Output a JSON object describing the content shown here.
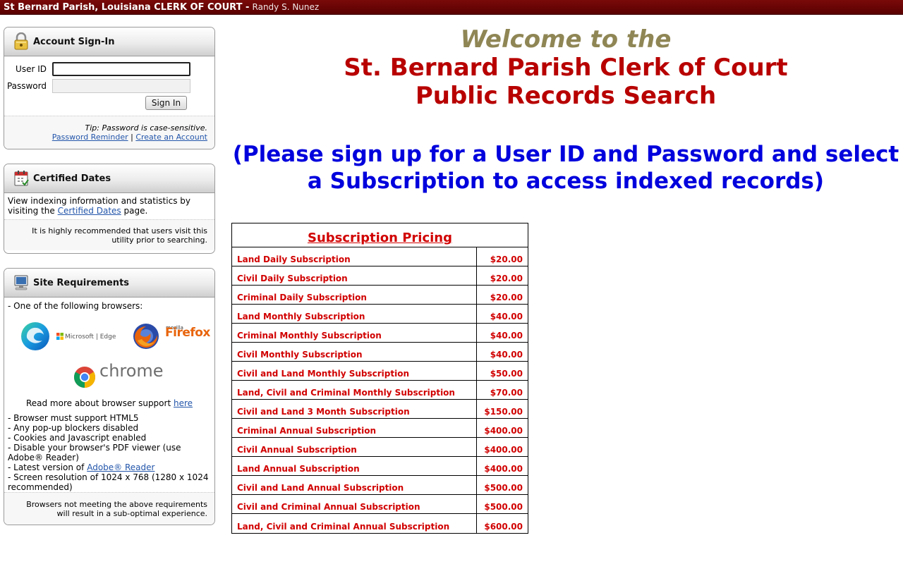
{
  "header": {
    "site_title": "St Bernard Parish, Louisiana CLERK OF COURT -",
    "clerk_name": "Randy S. Nunez"
  },
  "signin": {
    "title": "Account Sign-In",
    "icon": "lock-icon",
    "userid_label": "User ID",
    "userid_value": "",
    "password_label": "Password",
    "password_value": "",
    "signin_button": "Sign In",
    "tip": "Tip: Password is case-sensitive.",
    "password_reminder": "Password Reminder",
    "separator": "|",
    "create_account": "Create an Account"
  },
  "certified": {
    "title": "Certified Dates",
    "icon": "calendar-icon",
    "text_before": "View indexing information and statistics by visiting the",
    "link": "Certified Dates",
    "text_after": "page.",
    "note": "It is highly recommended that users visit this utility prior to searching."
  },
  "requirements": {
    "title": "Site Requirements",
    "icon": "computer-icon",
    "intro": "- One of the following browsers:",
    "edge_label": "Microsoft | Edge",
    "firefox_small": "mozilla",
    "firefox_label": "Firefox",
    "chrome_label": "chrome",
    "read_more": "Read more about browser support",
    "here_link": "here",
    "items": [
      "- Browser must support HTML5",
      "- Any pop-up blockers disabled",
      "- Cookies and Javascript enabled",
      "- Disable your browser's PDF viewer (use Adobe® Reader)"
    ],
    "latest_prefix": "- Latest version of",
    "adobe_link": "Adobe® Reader",
    "resolution": "- Screen resolution of 1024 x 768 (1280 x 1024 recommended)",
    "footer": "Browsers not meeting the above requirements will result in a sub-optimal experience."
  },
  "main": {
    "welcome": "Welcome to the",
    "title_line1": "St. Bernard Parish Clerk of Court",
    "title_line2": "Public Records Search",
    "notice": "(Please sign up for a User ID and Password and select a Subscription to access indexed records)"
  },
  "pricing": {
    "caption": "Subscription Pricing",
    "rows": [
      {
        "name": "Land Daily Subscription",
        "price": "$20.00"
      },
      {
        "name": "Civil Daily Subscription",
        "price": "$20.00"
      },
      {
        "name": "Criminal Daily Subscription",
        "price": "$20.00"
      },
      {
        "name": "Land Monthly Subscription",
        "price": "$40.00"
      },
      {
        "name": "Criminal Monthly Subscription",
        "price": "$40.00"
      },
      {
        "name": "Civil Monthly Subscription",
        "price": "$40.00"
      },
      {
        "name": "Civil and Land Monthly Subscription",
        "price": "$50.00"
      },
      {
        "name": "Land, Civil and Criminal Monthly Subscription",
        "price": "$70.00"
      },
      {
        "name": "Civil and Land 3 Month Subscription",
        "price": "$150.00"
      },
      {
        "name": "Criminal Annual Subscription",
        "price": "$400.00"
      },
      {
        "name": "Civil Annual Subscription",
        "price": "$400.00"
      },
      {
        "name": "Land Annual Subscription",
        "price": "$400.00"
      },
      {
        "name": "Civil and Land Annual Subscription",
        "price": "$500.00"
      },
      {
        "name": "Civil and Criminal Annual Subscription",
        "price": "$500.00"
      },
      {
        "name": "Land, Civil and Criminal Annual Subscription",
        "price": "$600.00"
      }
    ]
  },
  "colors": {
    "header_bg": "#6a0505",
    "welcome": "#8f8655",
    "title": "#b80000",
    "notice": "#0000dd",
    "pricing_text": "#d10000",
    "link": "#2255aa"
  }
}
